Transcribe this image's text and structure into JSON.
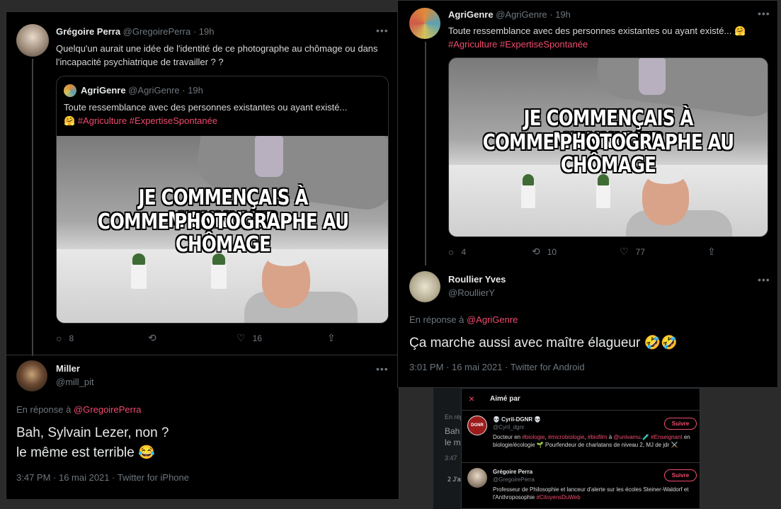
{
  "left": {
    "tweet": {
      "name": "Grégoire Perra",
      "handle": "@GregoirePerra · 19h",
      "text": "Quelqu'un aurait une idée de l'identité de ce photographe au chômage ou dans l'incapacité psychiatrique de travailler ? ?",
      "quote": {
        "name": "AgriGenre",
        "handle": "@AgriGenre · 19h",
        "text": "Toute ressemblance avec des personnes existantes ou ayant existé...",
        "emoji": "🤗",
        "hashtags": "#Agriculture #ExpertiseSpontanée",
        "meme_line1": "JE COMMENÇAIS À M'ENNUYER",
        "meme_line2": "COMME PHOTOGRAPHE AU CHÔMAGE"
      },
      "replies": "8",
      "retweets": "",
      "likes": "16"
    },
    "reply": {
      "name": "Miller",
      "handle": "@mill_pit",
      "in_reply_prefix": "En réponse à",
      "in_reply_to": "@GregoirePerra",
      "line1": "Bah, Sylvain Lezer, non ?",
      "line2": "le même est terrible 😂",
      "meta": "3:47 PM · 16 mai 2021 · Twitter for iPhone"
    }
  },
  "right": {
    "tweet": {
      "name": "AgriGenre",
      "handle": "@AgriGenre · 19h",
      "text": "Toute ressemblance avec des personnes existantes ou ayant existé...",
      "emoji": "🤗",
      "hashtags": "#Agriculture #ExpertiseSpontanée",
      "meme_line1": "JE COMMENÇAIS À M'ENNUYER",
      "meme_line2": "COMME PHOTOGRAPHE AU CHÔMAGE",
      "replies": "4",
      "retweets": "10",
      "likes": "77"
    },
    "reply": {
      "name": "Roullier Yves",
      "handle": "@RoullierY",
      "in_reply_prefix": "En réponse à",
      "in_reply_to": "@AgriGenre",
      "text": "Ça marche aussi avec maître élagueur 🤣🤣",
      "meta": "3:01 PM · 16 mai 2021 · Twitter for Android"
    }
  },
  "liked_by": {
    "title": "Aimé par",
    "close": "×",
    "users": [
      {
        "name": "💀 Cyril-DGNR 💀",
        "handle": "@Cyril_dgnr",
        "bio_parts": [
          "Docteur en ",
          "#biologie",
          ", ",
          "#microbiologie",
          ", ",
          "#biofilm",
          " à ",
          "@univamu",
          ".🧪 ",
          "#Enseignant",
          " en biologie/écologie 🌱 Pourfendeur de charlatans de niveau 2, MJ de jdr ⚔️"
        ],
        "follow": "Suivre",
        "avatar_label": "DGNR"
      },
      {
        "name": "Grégoire Perra",
        "handle": "@GregoirePerra",
        "bio_parts": [
          "Professeur de Philosophie et lanceur d'alerte sur les écoles Steiner-Waldorf et l'Anthroposophie ",
          "#CitoyensDuWeb"
        ],
        "follow": "Suivre"
      }
    ]
  },
  "background": {
    "frag1": "En rép",
    "frag2": "Bah",
    "frag3": "le m",
    "frag4": "3:47",
    "frag5": "2 J'a"
  }
}
